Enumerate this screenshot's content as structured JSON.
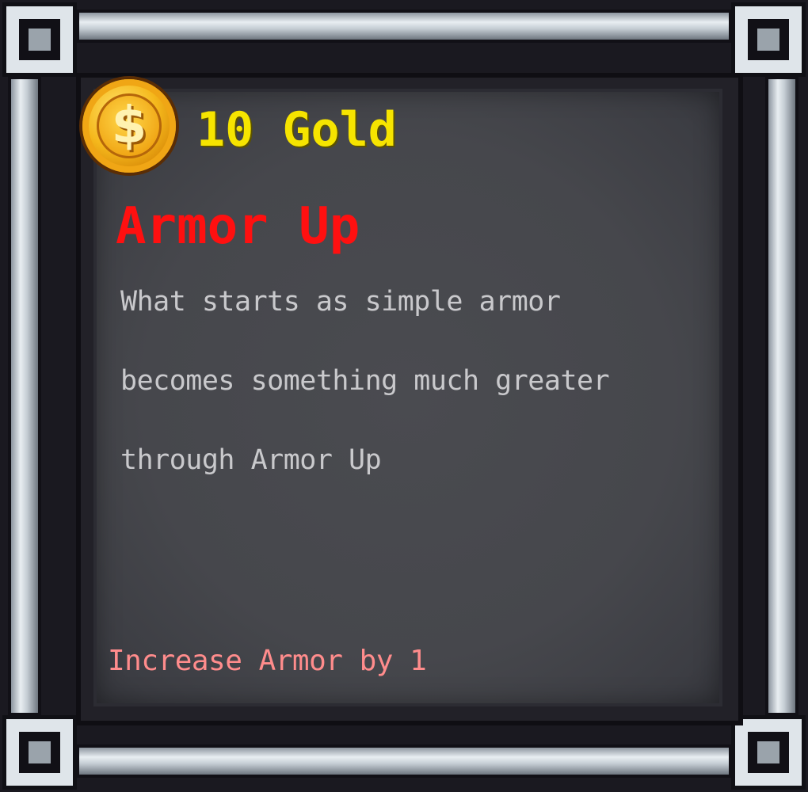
{
  "card": {
    "cost_text": "10 Gold",
    "coin_symbol": "$",
    "title": "Armor Up",
    "description_lines": [
      "What starts as simple armor",
      "becomes something much greater",
      "through Armor Up"
    ],
    "effect": "Increase Armor by 1",
    "colors": {
      "cost": "#f6e400",
      "title": "#ff1010",
      "description": "#c9c9cc",
      "effect": "#ff8c8c",
      "panel": "#46474c",
      "frame": "#dfe5ea"
    },
    "icons": {
      "currency": "gold-coin-icon"
    }
  }
}
